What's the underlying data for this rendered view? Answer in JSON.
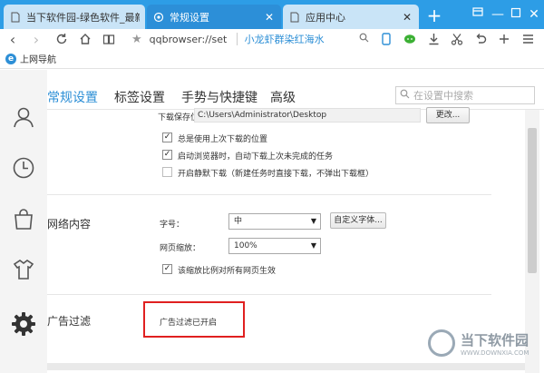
{
  "tabs": [
    {
      "label": "当下软件园-绿色软件_最新绿色下",
      "active": false,
      "icon": "page-icon"
    },
    {
      "label": "常规设置",
      "active": true,
      "icon": "settings-icon"
    },
    {
      "label": "应用中心",
      "active": false,
      "icon": "page-icon"
    }
  ],
  "toolbar": {
    "url": "qqbrowser://set",
    "related": "小龙虾群染红海水"
  },
  "bookmarks": {
    "item": "上网导航"
  },
  "settings": {
    "tabs": [
      "常规设置",
      "标签设置",
      "手势与快捷键",
      "高级"
    ],
    "search_placeholder": "在设置中搜索",
    "download": {
      "location_label": "下载保存位置",
      "path": "C:\\Users\\Administrator\\Desktop",
      "change_button": "更改...",
      "options": [
        {
          "label": "总是使用上次下载的位置",
          "checked": true
        },
        {
          "label": "启动浏览器时，自动下载上次未完成的任务",
          "checked": true
        },
        {
          "label": "开启静默下载（新建任务时直接下载，不弹出下载框）",
          "checked": false
        }
      ]
    },
    "web_content": {
      "title": "网络内容",
      "font_size_label": "字号：",
      "font_size_value": "中",
      "custom_font_button": "自定义字体...",
      "zoom_label": "网页缩放：",
      "zoom_value": "100%",
      "zoom_apply_all": "该缩放比例对所有网页生效",
      "zoom_apply_all_checked": true
    },
    "ad_filter": {
      "title": "广告过滤",
      "status": "广告过滤已开启"
    }
  },
  "watermark": {
    "text": "当下软件园",
    "sub": "WWW.DOWNXIA.COM"
  },
  "colors": {
    "accent": "#2d8fd6",
    "tabbar": "#2d9de6",
    "highlight": "#e02020"
  }
}
